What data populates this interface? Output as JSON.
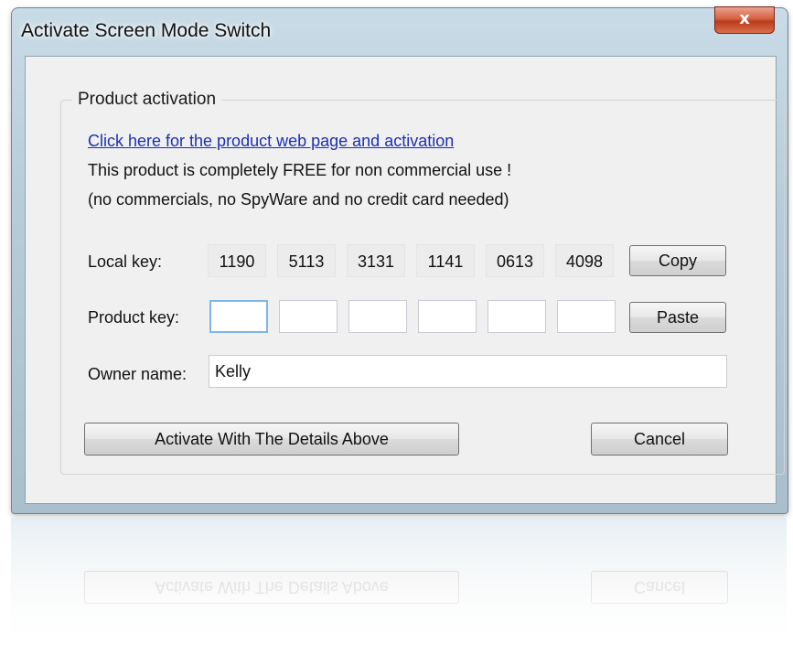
{
  "window": {
    "title": "Activate Screen Mode Switch",
    "close_label": "x"
  },
  "group": {
    "legend": "Product activation",
    "link_text": "Click here for the product web page and activation",
    "info_line1": "This product is completely FREE for non commercial use !",
    "info_line2": "(no commercials, no SpyWare and no credit card needed)"
  },
  "local_key": {
    "label": "Local key:",
    "parts": [
      "1190",
      "5113",
      "3131",
      "1141",
      "0613",
      "4098"
    ],
    "copy_label": "Copy"
  },
  "product_key": {
    "label": "Product key:",
    "parts": [
      "",
      "",
      "",
      "",
      "",
      ""
    ],
    "paste_label": "Paste"
  },
  "owner": {
    "label": "Owner name:",
    "value": "Kelly"
  },
  "buttons": {
    "activate_label": "Activate With The Details Above",
    "cancel_label": "Cancel"
  },
  "colors": {
    "link": "#1a2fb8",
    "close_button": "#c9462a",
    "focus_border": "#7fb6e8"
  }
}
